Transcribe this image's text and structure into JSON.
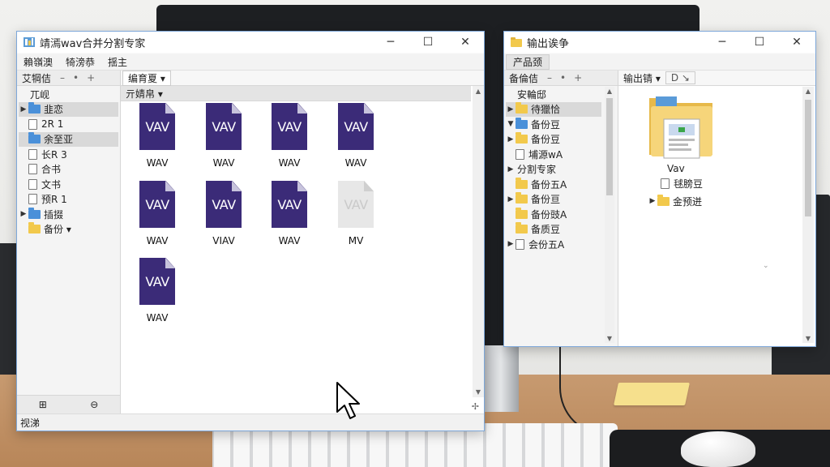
{
  "colors": {
    "window_border": "#7da7d9",
    "wav_icon": "#3b2b78",
    "folder_blue": "#4a90d9",
    "folder_yellow": "#f2c94c"
  },
  "left_window": {
    "title": "靖漹wav合并分割专家",
    "title_icon": "app-icon",
    "controls": {
      "minimize": "─",
      "maximize": "☐",
      "close": "✕"
    },
    "menu": [
      "賴嶺澳",
      "犄滂恭",
      "揺主"
    ],
    "tree_header": {
      "label": "艾犅佶",
      "btn1": "–",
      "btn2": "•",
      "btn3": "+"
    },
    "tree": [
      {
        "label": "兀岘",
        "expand": "",
        "icon": "none",
        "selected": false
      },
      {
        "label": "韭恋",
        "expand": "▶",
        "icon": "folder-blue",
        "selected": true
      },
      {
        "label": "2R 1",
        "expand": "",
        "icon": "file",
        "selected": false
      },
      {
        "label": "余至亚",
        "expand": "",
        "icon": "folder-blue",
        "selected": true
      },
      {
        "label": "长R 3",
        "expand": "",
        "icon": "file",
        "selected": false
      },
      {
        "label": "合书",
        "expand": "",
        "icon": "file",
        "selected": false
      },
      {
        "label": "文书",
        "expand": "",
        "icon": "file",
        "selected": false
      },
      {
        "label": "预R 1",
        "expand": "",
        "icon": "file",
        "selected": false
      },
      {
        "label": "插掇",
        "expand": "▶",
        "icon": "folder-blue",
        "selected": false
      },
      {
        "label": "备份 ▾",
        "expand": "",
        "icon": "folder-yellow",
        "selected": false
      }
    ],
    "pane_footer": {
      "left_icon": "⊞",
      "right_icon": "⊖"
    },
    "content_header": {
      "dropdown": "编育夏 ▾",
      "sort": "亓婧帛 ▾"
    },
    "files": [
      {
        "icon_text": "VAV",
        "label": "WAV",
        "grey": false
      },
      {
        "icon_text": "VAV",
        "label": "WAV",
        "grey": false
      },
      {
        "icon_text": "VAV",
        "label": "WAV",
        "grey": false
      },
      {
        "icon_text": "VAV",
        "label": "WAV",
        "grey": false
      },
      {
        "icon_text": "VAV",
        "label": "WAV",
        "grey": false
      },
      {
        "icon_text": "VAV",
        "label": "VIAV",
        "grey": false
      },
      {
        "icon_text": "VAV",
        "label": "WAV",
        "grey": false
      },
      {
        "icon_text": "VAV",
        "label": "MV",
        "grey": true
      },
      {
        "icon_text": "VAV",
        "label": "WAV",
        "grey": false
      }
    ],
    "status": "视涕"
  },
  "right_window": {
    "title": "输出诶争",
    "controls": {
      "minimize": "─",
      "maximize": "☐",
      "close": "✕"
    },
    "menu": [
      "产品颈"
    ],
    "tree_header": {
      "label": "备倫佶",
      "btn1": "–",
      "btn2": "•",
      "btn3": "+"
    },
    "tree": [
      {
        "label": "安輪邸",
        "expand": "",
        "icon": "none",
        "selected": false
      },
      {
        "label": "待獵恰",
        "expand": "▶",
        "icon": "folder-yellow",
        "selected": true
      },
      {
        "label": "备份豆",
        "expand": "▼",
        "icon": "folder-blue",
        "selected": false
      },
      {
        "label": "备份豆",
        "expand": "▶",
        "icon": "folder-yellow",
        "selected": false
      },
      {
        "label": "埔源wA",
        "expand": "",
        "icon": "file",
        "selected": false
      },
      {
        "label": "分割专家",
        "expand": "▶",
        "icon": "none",
        "selected": false
      },
      {
        "label": "备份五A",
        "expand": "",
        "icon": "folder-yellow",
        "selected": false
      },
      {
        "label": "备份亘",
        "expand": "▶",
        "icon": "folder-yellow",
        "selected": false
      },
      {
        "label": "备份豉A",
        "expand": "",
        "icon": "folder-yellow",
        "selected": false
      },
      {
        "label": "备质豆",
        "expand": "",
        "icon": "folder-yellow",
        "selected": false
      },
      {
        "label": "会份五A",
        "expand": "▶",
        "icon": "file",
        "selected": false
      }
    ],
    "content_header": {
      "dropdown": "输出锖 ▾",
      "btn": "D ↘"
    },
    "preview": {
      "folder_caption": "Vav",
      "item1": "毬膀豆",
      "item2": "金预迸"
    }
  }
}
